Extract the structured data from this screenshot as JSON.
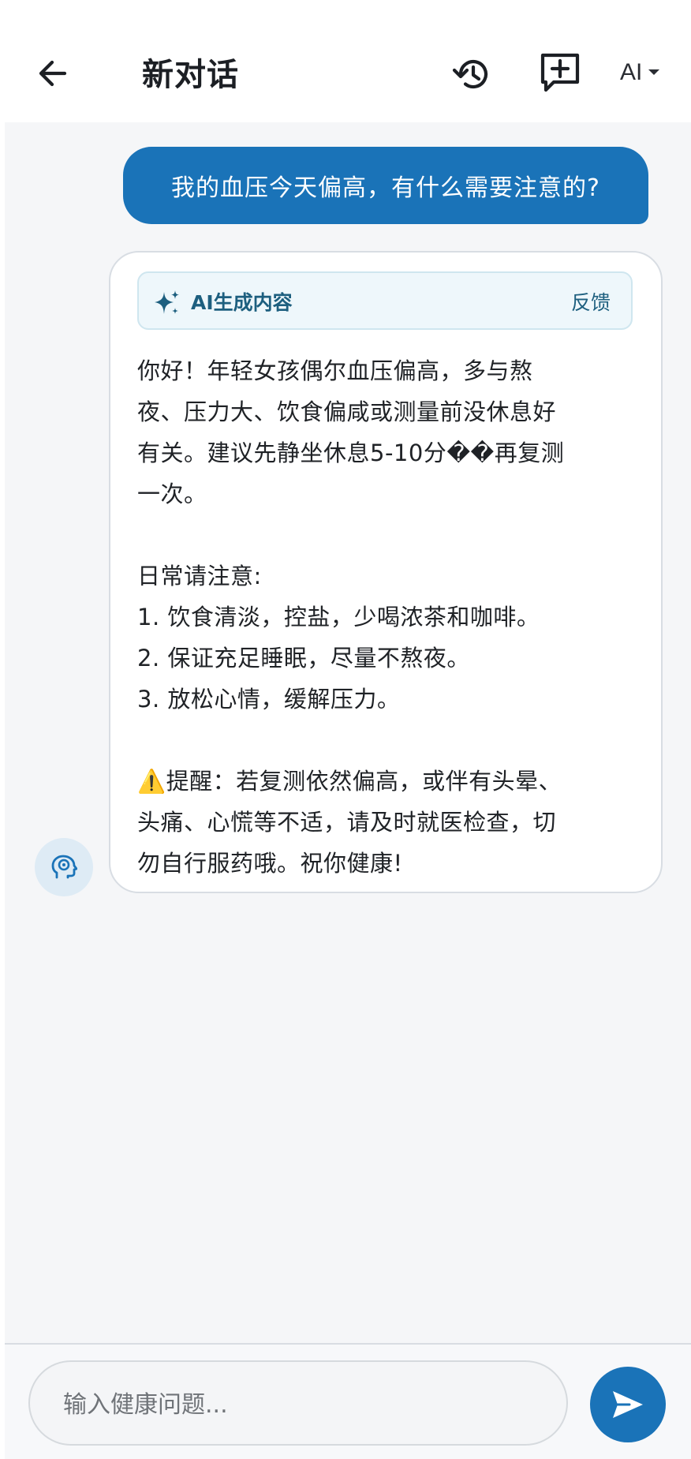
{
  "header": {
    "title": "新对话",
    "model_label": "AI",
    "icons": [
      "back-arrow-icon",
      "history-icon",
      "new-chat-icon",
      "caret-down-icon"
    ]
  },
  "conversation": {
    "user_message": "我的血压今天偏高，有什么需要注意的?",
    "ai_card": {
      "badge_label": "AI生成内容",
      "feedback_label": "反馈",
      "paragraph_1": [
        "你好！年轻女孩偶尔血压偏高，多与熬",
        "夜、压力大、饮食偏咸或测量前没休息好",
        "有关。建议先静坐休息5-10分��再复测",
        "一次。"
      ],
      "list_title": "日常请注意:",
      "list_items": [
        "1. 饮食清淡，控盐，少喝浓茶和咖啡。",
        "2. 保证充足睡眠，尽量不熬夜。",
        "3. 放松心情，缓解压力。"
      ],
      "reminder": [
        "⚠️提醒：若复测依然偏高，或伴有头晕、",
        "头痛、心慌等不适，请及时就医检查，切",
        "勿自行服药哦。祝你健康!"
      ]
    }
  },
  "composer": {
    "placeholder": "输入健康问题...",
    "value": ""
  },
  "colors": {
    "accent": "#1a73b8",
    "badge_text": "#1d5f7f",
    "background": "#f5f6f8"
  }
}
